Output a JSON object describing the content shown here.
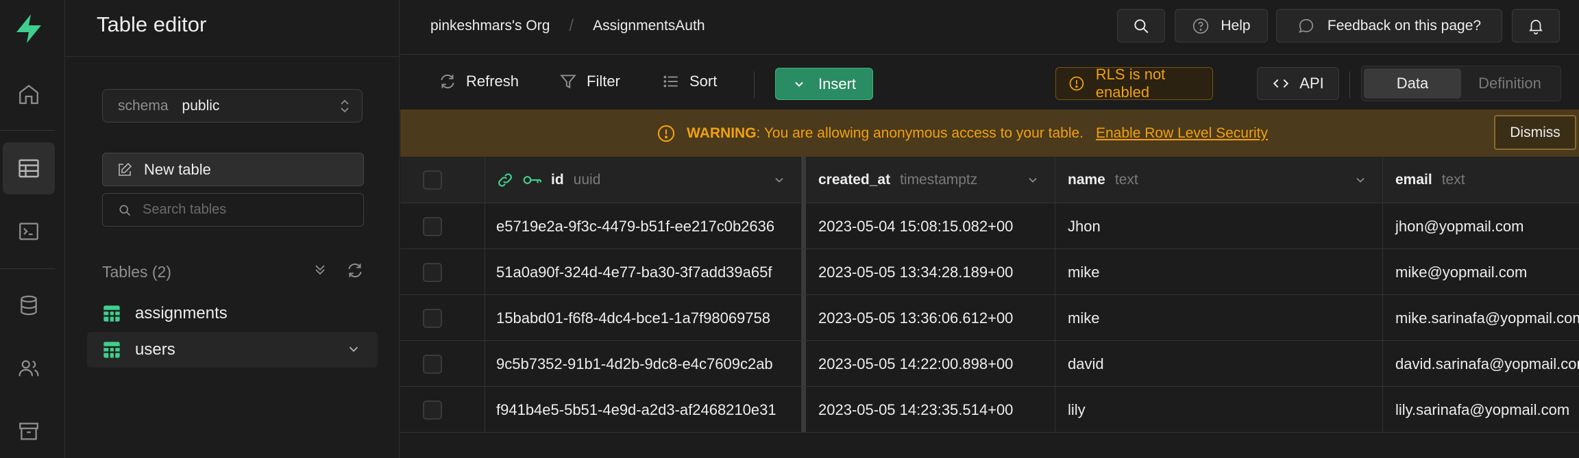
{
  "rail": {
    "items": [
      "home-icon",
      "table-editor-icon",
      "sql-editor-icon",
      "database-icon",
      "auth-icon",
      "storage-icon"
    ],
    "brand_color": "#3ecf8e"
  },
  "side": {
    "title": "Table editor",
    "schema_label": "schema",
    "schema_value": "public",
    "new_table_label": "New table",
    "search_placeholder": "Search tables",
    "tables_heading": "Tables (2)",
    "tables": [
      {
        "name": "assignments"
      },
      {
        "name": "users"
      }
    ]
  },
  "topbar": {
    "org": "pinkeshmars's Org",
    "project": "AssignmentsAuth",
    "help_label": "Help",
    "feedback_label": "Feedback on this page?"
  },
  "toolbar": {
    "refresh_label": "Refresh",
    "filter_label": "Filter",
    "sort_label": "Sort",
    "insert_label": "Insert",
    "rls_label": "RLS is not enabled",
    "api_label": "API",
    "view_options": [
      "Data",
      "Definition"
    ],
    "selected_view": "Data"
  },
  "warning": {
    "strong": "WARNING",
    "message": ": You are allowing anonymous access to your table.",
    "link": "Enable Row Level Security",
    "dismiss_label": "Dismiss"
  },
  "grid": {
    "columns": [
      {
        "name": "id",
        "type": "uuid"
      },
      {
        "name": "created_at",
        "type": "timestamptz"
      },
      {
        "name": "name",
        "type": "text"
      },
      {
        "name": "email",
        "type": "text"
      }
    ],
    "rows": [
      [
        "e5719e2a-9f3c-4479-b51f-ee217c0b2636",
        "2023-05-04 15:08:15.082+00",
        "Jhon",
        "jhon@yopmail.com"
      ],
      [
        "51a0a90f-324d-4e77-ba30-3f7add39a65f",
        "2023-05-05 13:34:28.189+00",
        "mike",
        "mike@yopmail.com"
      ],
      [
        "15babd01-f6f8-4dc4-bce1-1a7f98069758",
        "2023-05-05 13:36:06.612+00",
        "mike",
        "mike.sarinafa@yopmail.com"
      ],
      [
        "9c5b7352-91b1-4d2b-9dc8-e4c7609c2ab",
        "2023-05-05 14:22:00.898+00",
        "david",
        "david.sarinafa@yopmail.com"
      ],
      [
        "f941b4e5-5b51-4e9d-a2d3-af2468210e31",
        "2023-05-05 14:23:35.514+00",
        "lily",
        "lily.sarinafa@yopmail.com"
      ]
    ]
  },
  "colors": {
    "accent": "#3ecf8e",
    "insert_bg": "#2a8c62",
    "warning_text": "#f1a10d",
    "warning_bg": "#4b3a1b"
  }
}
